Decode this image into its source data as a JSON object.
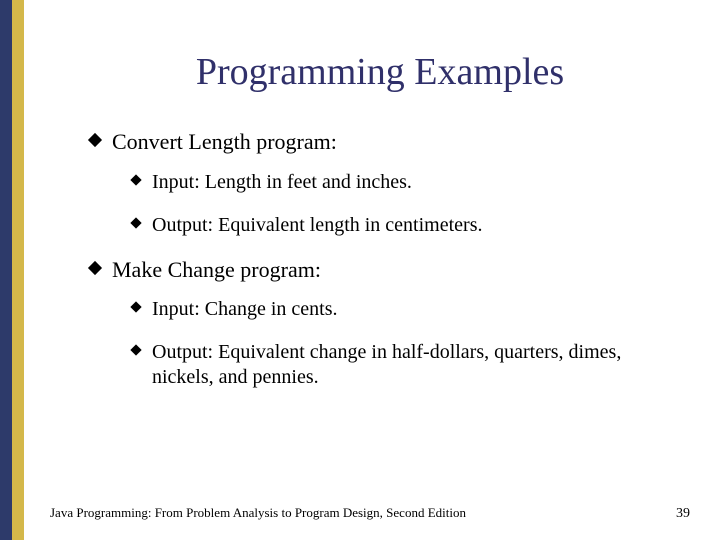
{
  "title": "Programming Examples",
  "bullets": [
    {
      "text": "Convert Length program:",
      "sub": [
        "Input: Length in feet and inches.",
        "Output: Equivalent length in centimeters."
      ]
    },
    {
      "text": "Make Change program:",
      "sub": [
        "Input: Change in cents.",
        "Output: Equivalent change in half-dollars, quarters, dimes, nickels, and pennies."
      ]
    }
  ],
  "footer": {
    "source": "Java Programming: From Problem Analysis to Program Design, Second Edition",
    "page": "39"
  },
  "colors": {
    "title": "#30306a",
    "stripe_navy": "#2d3a6a",
    "stripe_gold": "#d4b84a"
  }
}
